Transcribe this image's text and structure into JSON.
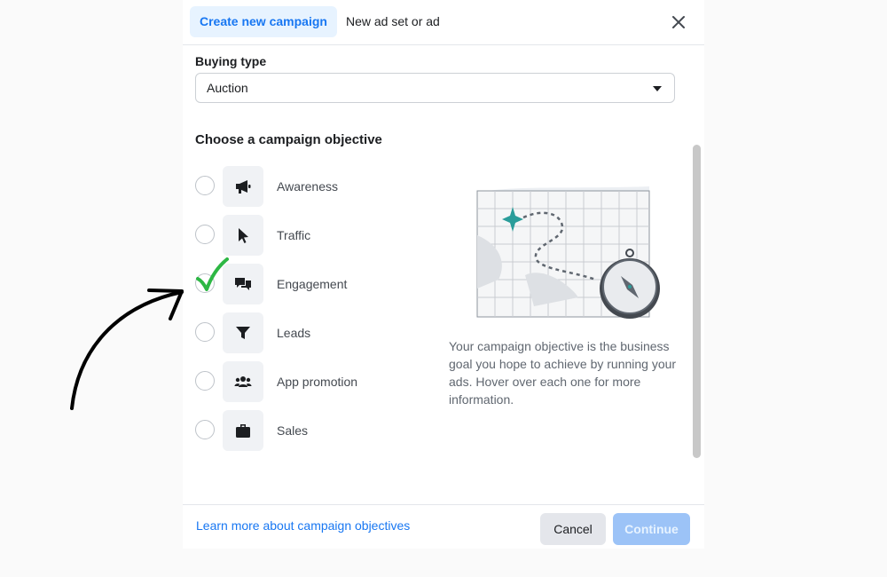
{
  "tabs": [
    {
      "label": "Create new campaign",
      "active": true
    },
    {
      "label": "New ad set or ad",
      "active": false
    }
  ],
  "buying_type": {
    "label": "Buying type",
    "value": "Auction"
  },
  "objective": {
    "heading": "Choose a campaign objective",
    "options": [
      {
        "label": "Awareness",
        "icon": "megaphone-icon"
      },
      {
        "label": "Traffic",
        "icon": "cursor-icon"
      },
      {
        "label": "Engagement",
        "icon": "chat-bubbles-icon",
        "annotated": true
      },
      {
        "label": "Leads",
        "icon": "funnel-icon"
      },
      {
        "label": "App promotion",
        "icon": "people-icon"
      },
      {
        "label": "Sales",
        "icon": "briefcase-icon"
      }
    ],
    "description": "Your campaign objective is the business goal you hope to achieve by running your ads. Hover over each one for more information."
  },
  "footer": {
    "learn_more": "Learn more about campaign objectives",
    "cancel": "Cancel",
    "continue": "Continue"
  },
  "colors": {
    "accent": "#1877f2",
    "annotation_check": "#2db744",
    "annotation_arrow": "#000000"
  }
}
